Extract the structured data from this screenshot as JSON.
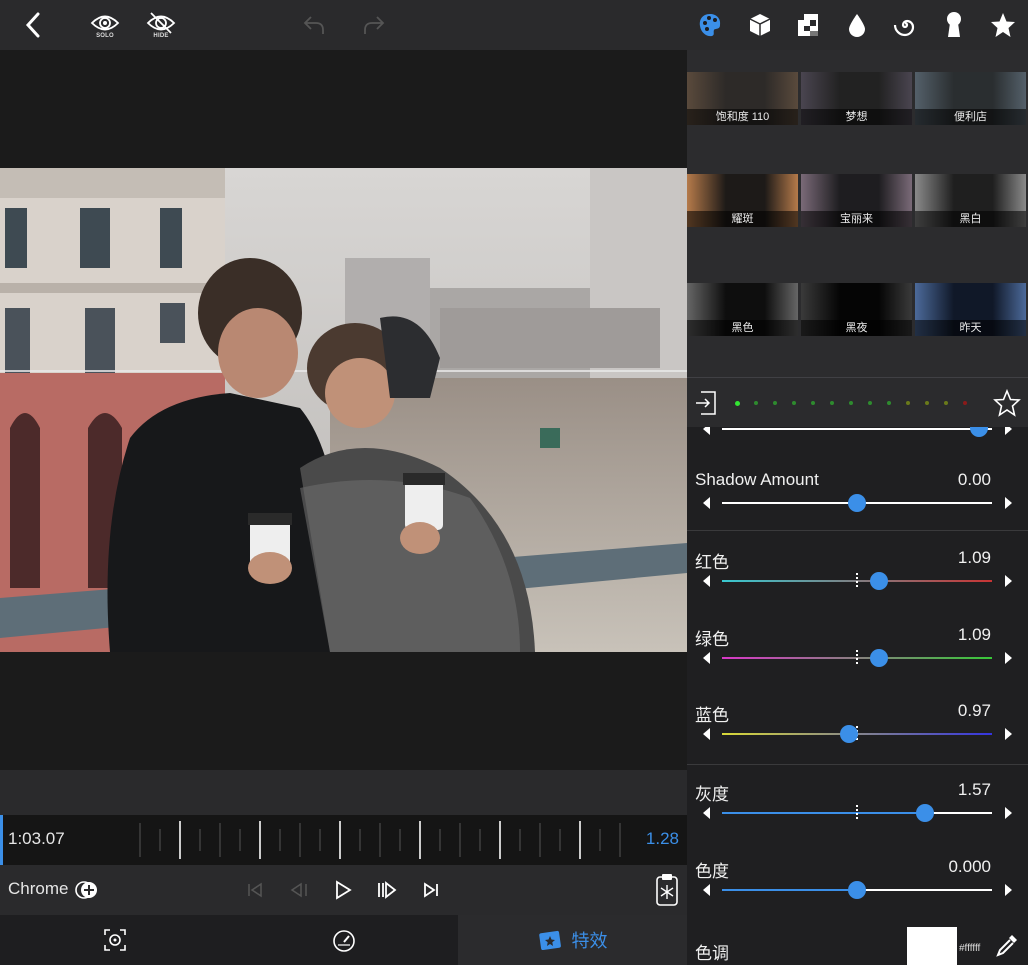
{
  "toolbar": {
    "solo_label": "SOLO",
    "hide_label": "HIDE",
    "accent": "#3b8fe8",
    "tabs": [
      "palette-icon",
      "cube-icon",
      "texture-icon",
      "drop-icon",
      "spiral-icon",
      "keyhole-icon",
      "star-icon"
    ]
  },
  "filters": [
    {
      "label": "饱和度 110"
    },
    {
      "label": "梦想"
    },
    {
      "label": "便利店"
    },
    {
      "label": "耀斑"
    },
    {
      "label": "宝丽来"
    },
    {
      "label": "黑白"
    },
    {
      "label": "黑色"
    },
    {
      "label": "黑夜"
    },
    {
      "label": "昨天"
    },
    {
      "label": ""
    },
    {
      "label": ""
    },
    {
      "label": ""
    }
  ],
  "timeline": {
    "current_time": "1:03.07",
    "duration": "1.28"
  },
  "transport": {
    "filter_name": "Chrome"
  },
  "bottom_nav": {
    "effects_label": "特效"
  },
  "sliders": [
    {
      "label": "Shadow Amount",
      "value": "0.00",
      "position": 0.5,
      "track": "#ffffff"
    },
    {
      "label": "红色",
      "value": "1.09",
      "position": 0.58,
      "track": "red"
    },
    {
      "label": "绿色",
      "value": "1.09",
      "position": 0.58,
      "track": "green"
    },
    {
      "label": "蓝色",
      "value": "0.97",
      "position": 0.47,
      "track": "blue"
    },
    {
      "label": "灰度",
      "value": "1.57",
      "position": 0.75,
      "track": "gray"
    },
    {
      "label": "色度",
      "value": "0.000",
      "position": 0.5,
      "track": "white"
    }
  ],
  "tint": {
    "label": "色调",
    "hex": "#ffffff"
  }
}
